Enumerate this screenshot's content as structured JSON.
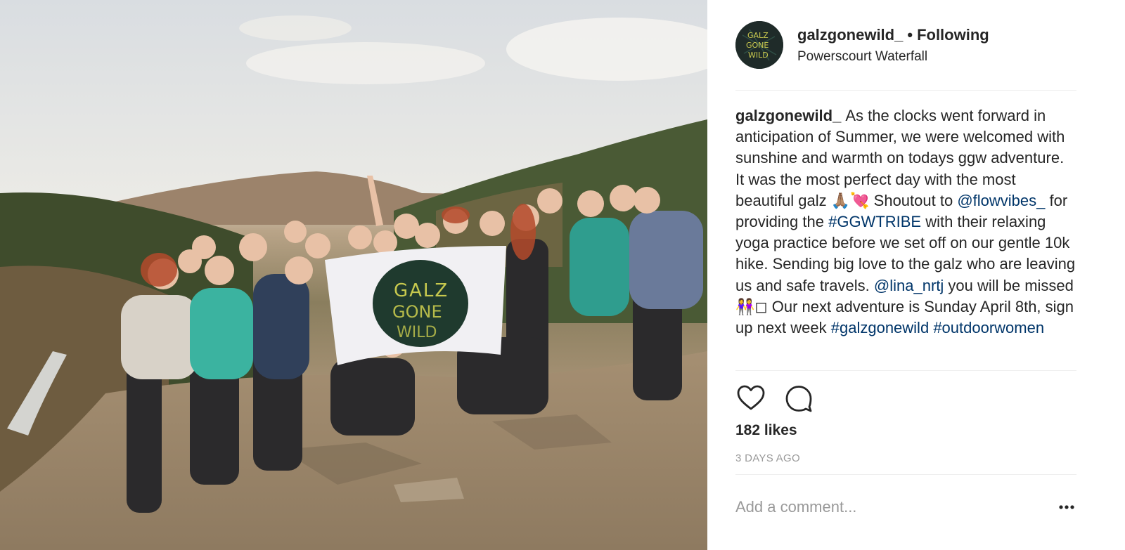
{
  "post": {
    "image": {
      "description_icon": "group-photo",
      "banner_text": "GALZ GONE WILD"
    },
    "header": {
      "username": "galzgonewild_",
      "separator": "•",
      "follow_status": "Following",
      "location": "Powerscourt Waterfall",
      "avatar_text": "GALZ GONE WILD"
    },
    "caption": {
      "username": "galzgonewild_",
      "text_1": "As the clocks went forward in anticipation of Summer, we were welcomed with sunshine and warmth on todays ggw adventure. It was the most perfect day with the most beautiful galz 🙏🏽💘 Shoutout to ",
      "mention_1": "@flowvibes_",
      "text_2": " for providing the ",
      "hashtag_1": "#GGWTRIBE",
      "text_3": " with their relaxing yoga practice before we set off on our gentle 10k hike. Sending big love to the galz who are leaving us and safe travels. ",
      "mention_2": "@lina_nrtj",
      "text_4": " you will be missed 👭◻ Our next adventure is Sunday April 8th, sign up next week ",
      "hashtag_2": "#galzgonewild",
      "hashtag_3": "#outdoorwomen"
    },
    "actions": {
      "like_icon": "heart-icon",
      "comment_icon": "comment-icon"
    },
    "likes": "182 likes",
    "timestamp": "3 DAYS AGO",
    "comment_box": {
      "placeholder": "Add a comment...",
      "more_icon": "ellipsis-icon"
    }
  },
  "colors": {
    "text": "#262626",
    "link": "#003569",
    "muted": "#999999",
    "divider": "#efefef"
  }
}
